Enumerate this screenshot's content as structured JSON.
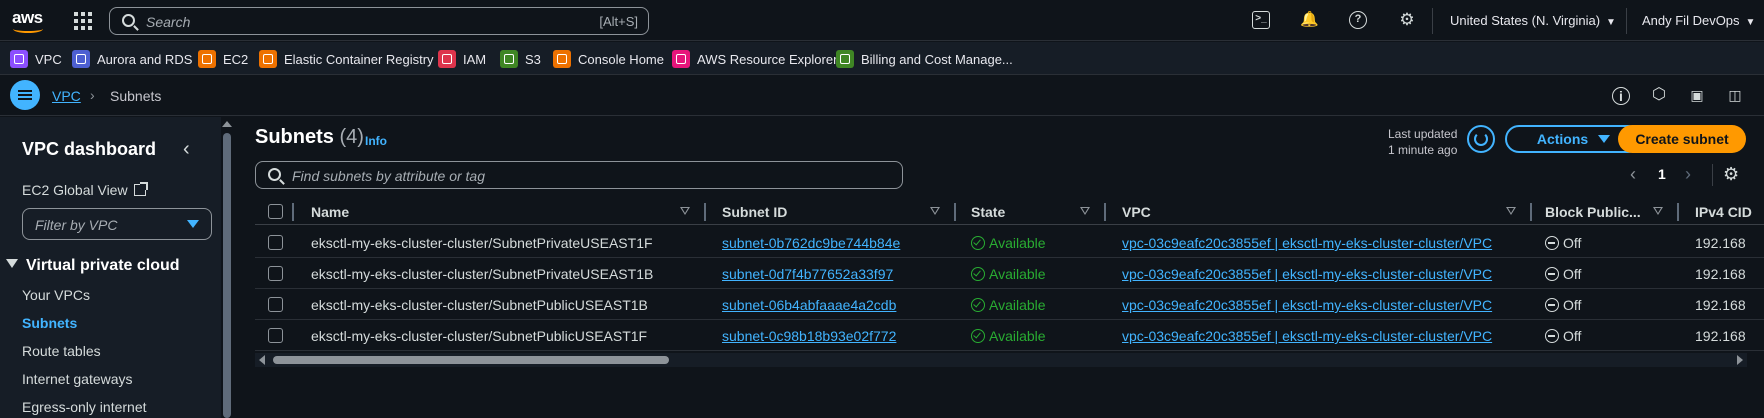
{
  "topbar": {
    "logo_text": "aws",
    "search_placeholder": "Search",
    "search_shortcut": "[Alt+S]",
    "region": "United States (N. Virginia)",
    "account": "Andy Fil DevOps"
  },
  "favorites": [
    {
      "label": "VPC",
      "color": "#8c4fff"
    },
    {
      "label": "Aurora and RDS",
      "color": "#4d5fd1"
    },
    {
      "label": "EC2",
      "color": "#ed7100"
    },
    {
      "label": "Elastic Container Registry",
      "color": "#ed7100"
    },
    {
      "label": "IAM",
      "color": "#dd344c"
    },
    {
      "label": "S3",
      "color": "#3f8624"
    },
    {
      "label": "Console Home",
      "color": "#ed7100"
    },
    {
      "label": "AWS Resource Explorer",
      "color": "#e7157b"
    },
    {
      "label": "Billing and Cost Manage...",
      "color": "#3f8624"
    }
  ],
  "breadcrumb": {
    "parent": "VPC",
    "separator": "›",
    "current": "Subnets"
  },
  "sidebar": {
    "title": "VPC dashboard",
    "ec2_global_view": "EC2 Global View",
    "filter_placeholder": "Filter by VPC",
    "section": "Virtual private cloud",
    "items": [
      "Your VPCs",
      "Subnets",
      "Route tables",
      "Internet gateways",
      "Egress-only internet"
    ]
  },
  "main": {
    "title": "Subnets",
    "count": "(4)",
    "info": "Info",
    "last_updated_label": "Last updated",
    "last_updated_value": "1 minute ago",
    "actions_label": "Actions",
    "create_label": "Create subnet",
    "search_placeholder": "Find subnets by attribute or tag",
    "page": "1"
  },
  "table": {
    "columns": [
      "Name",
      "Subnet ID",
      "State",
      "VPC",
      "Block Public...",
      "IPv4 CID"
    ],
    "rows": [
      {
        "name": "eksctl-my-eks-cluster-cluster/SubnetPrivateUSEAST1F",
        "id": "subnet-0b762dc9be744b84e",
        "state": "Available",
        "vpc": "vpc-03c9eafc20c3855ef | eksctl-my-eks-cluster-cluster/VPC",
        "block": "Off",
        "ipv4": "192.168"
      },
      {
        "name": "eksctl-my-eks-cluster-cluster/SubnetPrivateUSEAST1B",
        "id": "subnet-0d7f4b77652a33f97",
        "state": "Available",
        "vpc": "vpc-03c9eafc20c3855ef | eksctl-my-eks-cluster-cluster/VPC",
        "block": "Off",
        "ipv4": "192.168"
      },
      {
        "name": "eksctl-my-eks-cluster-cluster/SubnetPublicUSEAST1B",
        "id": "subnet-06b4abfaaae4a2cdb",
        "state": "Available",
        "vpc": "vpc-03c9eafc20c3855ef | eksctl-my-eks-cluster-cluster/VPC",
        "block": "Off",
        "ipv4": "192.168"
      },
      {
        "name": "eksctl-my-eks-cluster-cluster/SubnetPublicUSEAST1F",
        "id": "subnet-0c98b18b93e02f772",
        "state": "Available",
        "vpc": "vpc-03c9eafc20c3855ef | eksctl-my-eks-cluster-cluster/VPC",
        "block": "Off",
        "ipv4": "192.168"
      }
    ]
  },
  "colors": {
    "accent": "#42b4ff",
    "primary_button": "#ff9900",
    "available": "#29ad32",
    "background": "#0f141a"
  }
}
